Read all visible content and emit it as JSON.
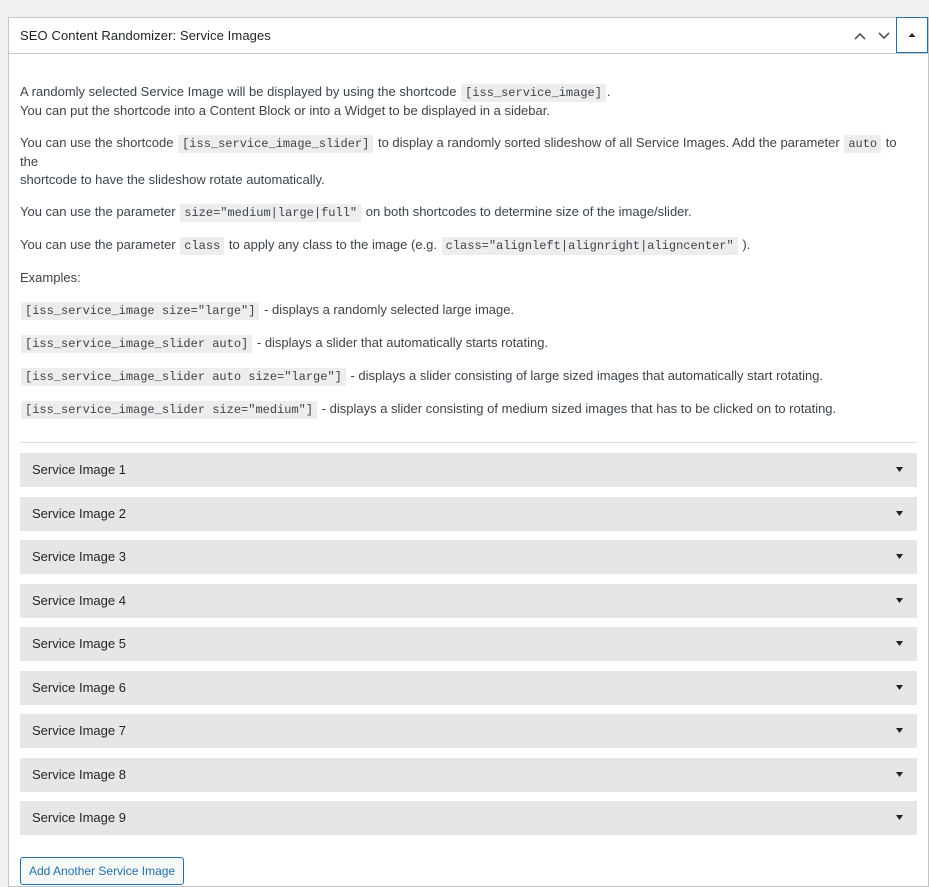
{
  "box": {
    "title": "SEO Content Randomizer: Service Images",
    "move_up_icon": "chevron-up-icon",
    "move_down_icon": "chevron-down-icon",
    "toggle_icon": "triangle-up-icon"
  },
  "paragraphs": {
    "p1_text_a": "A randomly selected Service Image will be displayed by using the shortcode",
    "p1_code": "[iss_service_image]",
    "p1_text_b": ".",
    "p1_line2": "You can put the shortcode into a Content Block or into a Widget to be displayed in a sidebar.",
    "p2_text_a": "You can use the shortcode",
    "p2_code_a": "[iss_service_image_slider]",
    "p2_text_b": "to display a randomly sorted slideshow of all Service Images. Add the parameter",
    "p2_code_b": "auto",
    "p2_text_c": "to the",
    "p2_line2": "shortcode to have the slideshow rotate automatically.",
    "p3_text_a": "You can use the parameter",
    "p3_code": "size=\"medium|large|full\"",
    "p3_text_b": "on both shortcodes to determine size of the image/slider.",
    "p4_text_a": "You can use the parameter",
    "p4_code_a": "class",
    "p4_text_b": "to apply any class to the image (e.g.",
    "p4_code_b": "class=\"alignleft|alignright|aligncenter\"",
    "p4_text_c": ").",
    "examples_label": "Examples:"
  },
  "examples": [
    {
      "code": "[iss_service_image size=\"large\"]",
      "desc": "- displays a randomly selected large image."
    },
    {
      "code": "[iss_service_image_slider auto]",
      "desc": "- displays a slider that automatically starts rotating."
    },
    {
      "code": "[iss_service_image_slider auto size=\"large\"]",
      "desc": "- displays a slider consisting of large sized images that automatically start rotating."
    },
    {
      "code": "[iss_service_image_slider size=\"medium\"]",
      "desc": "- displays a slider consisting of medium sized images that has to be clicked on to rotating."
    }
  ],
  "service_images": [
    {
      "label": "Service Image 1"
    },
    {
      "label": "Service Image 2"
    },
    {
      "label": "Service Image 3"
    },
    {
      "label": "Service Image 4"
    },
    {
      "label": "Service Image 5"
    },
    {
      "label": "Service Image 6"
    },
    {
      "label": "Service Image 7"
    },
    {
      "label": "Service Image 8"
    },
    {
      "label": "Service Image 9"
    }
  ],
  "add_button_label": "Add Another Service Image",
  "colors": {
    "accent": "#2271b1",
    "item_bg": "#e6e6e6",
    "text": "#3c434a"
  }
}
